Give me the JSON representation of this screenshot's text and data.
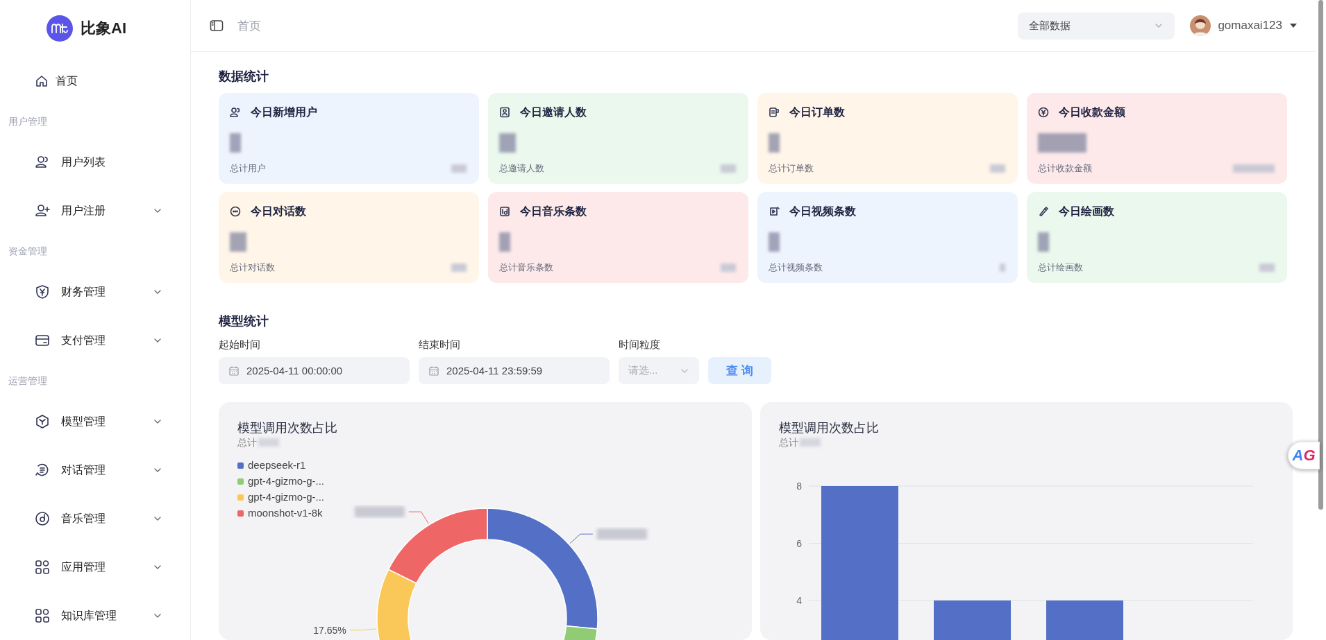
{
  "brand": {
    "name": "比象AI"
  },
  "sidebar": {
    "groups": [
      {
        "items": [
          {
            "label": "首页",
            "kind": "link"
          }
        ]
      },
      {
        "heading": "用户管理",
        "items": [
          {
            "label": "用户列表",
            "kind": "link"
          },
          {
            "label": "用户注册",
            "kind": "submenu",
            "expanded": false
          }
        ]
      },
      {
        "heading": "资金管理",
        "items": [
          {
            "label": "财务管理",
            "kind": "submenu",
            "expanded": false
          },
          {
            "label": "支付管理",
            "kind": "submenu",
            "expanded": false
          }
        ]
      },
      {
        "heading": "运营管理",
        "items": [
          {
            "label": "模型管理",
            "kind": "submenu",
            "expanded": false
          },
          {
            "label": "对话管理",
            "kind": "submenu",
            "expanded": false
          },
          {
            "label": "音乐管理",
            "kind": "submenu",
            "expanded": false
          },
          {
            "label": "应用管理",
            "kind": "submenu",
            "expanded": false
          },
          {
            "label": "知识库管理",
            "kind": "submenu",
            "expanded": false
          }
        ]
      }
    ]
  },
  "header": {
    "breadcrumb": "首页",
    "scope_select": {
      "value": "全部数据"
    },
    "user": {
      "name": "gomaxai123"
    }
  },
  "data_stats": {
    "title": "数据统计",
    "cards": [
      {
        "title": "今日新增用户",
        "total_label": "总计用户",
        "color": "#eef4fe"
      },
      {
        "title": "今日邀请人数",
        "total_label": "总邀请人数",
        "color": "#eaf8ed"
      },
      {
        "title": "今日订单数",
        "total_label": "总计订单数",
        "color": "#fff5e8"
      },
      {
        "title": "今日收款金额",
        "total_label": "总计收款金额",
        "color": "#fde9e9"
      },
      {
        "title": "今日对话数",
        "total_label": "总计对话数",
        "color": "#fff5e8"
      },
      {
        "title": "今日音乐条数",
        "total_label": "总计音乐条数",
        "color": "#fde9e9"
      },
      {
        "title": "今日视频条数",
        "total_label": "总计视频条数",
        "color": "#eef4fe"
      },
      {
        "title": "今日绘画数",
        "total_label": "总计绘画数",
        "color": "#eaf8ed"
      }
    ]
  },
  "model_stats": {
    "title": "模型统计",
    "filters": [
      {
        "label": "起始时间",
        "kind": "date",
        "value": "2025-04-11 00:00:00"
      },
      {
        "label": "结束时间",
        "kind": "date",
        "value": "2025-04-11 23:59:59"
      },
      {
        "label": "时间粒度",
        "kind": "select",
        "placeholder": "请选..."
      }
    ],
    "query_button": "查 询",
    "charts": [
      {
        "title": "模型调用次数占比",
        "subtitle": "总计",
        "chart_data": {
          "type": "donut",
          "categories": [
            "deepseek-r1",
            "gpt-4-gizmo-g-...",
            "gpt-4-gizmo-g-...",
            "moonshot-v1-8k"
          ],
          "series": [
            {
              "values": [
                26.5,
                38.2,
                17.65,
                17.65
              ]
            }
          ],
          "colors": [
            "#5470c6",
            "#91cc75",
            "#fac858",
            "#ee6666"
          ],
          "value_labels": [
            null,
            null,
            "17.65%",
            null
          ]
        }
      },
      {
        "title": "模型调用次数占比",
        "subtitle": "总计",
        "chart_data": {
          "type": "bar",
          "ylim": [
            0,
            8
          ],
          "yticks": [
            4,
            6,
            8
          ],
          "series": [
            {
              "color": "#5470c6",
              "values": [
                8,
                4,
                4
              ]
            }
          ]
        }
      }
    ]
  },
  "floating_button": {
    "label": "AG"
  }
}
